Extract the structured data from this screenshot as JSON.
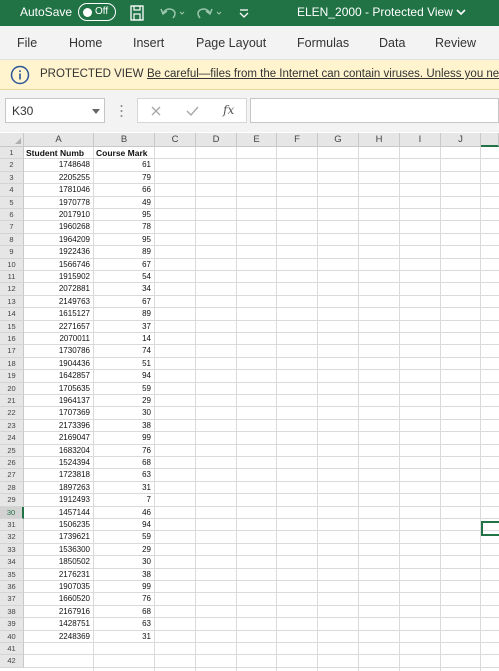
{
  "titlebar": {
    "autosave_label": "AutoSave",
    "autosave_state": "Off",
    "doc_title": "ELEN_2000  -  Protected View"
  },
  "ribbon_tabs": [
    "File",
    "Home",
    "Insert",
    "Page Layout",
    "Formulas",
    "Data",
    "Review"
  ],
  "protected_view": {
    "title": "PROTECTED VIEW",
    "message": "Be careful—files from the Internet can contain viruses. Unless you ne"
  },
  "formula_bar": {
    "name_box": "K30",
    "fx_label": "fx",
    "formula": ""
  },
  "columns": [
    "A",
    "B",
    "C",
    "D",
    "E",
    "F",
    "G",
    "H",
    "I",
    "J"
  ],
  "active_row": 30,
  "sheet": {
    "headers": [
      "Student Numb",
      "Course Mark"
    ],
    "rows": [
      [
        "1748648",
        "61"
      ],
      [
        "2205255",
        "79"
      ],
      [
        "1781046",
        "66"
      ],
      [
        "1970778",
        "49"
      ],
      [
        "2017910",
        "95"
      ],
      [
        "1960268",
        "78"
      ],
      [
        "1964209",
        "95"
      ],
      [
        "1922436",
        "89"
      ],
      [
        "1566746",
        "67"
      ],
      [
        "1915902",
        "54"
      ],
      [
        "2072881",
        "34"
      ],
      [
        "2149763",
        "67"
      ],
      [
        "1615127",
        "89"
      ],
      [
        "2271657",
        "37"
      ],
      [
        "2070011",
        "14"
      ],
      [
        "1730786",
        "74"
      ],
      [
        "1904436",
        "51"
      ],
      [
        "1642857",
        "94"
      ],
      [
        "1705635",
        "59"
      ],
      [
        "1964137",
        "29"
      ],
      [
        "1707369",
        "30"
      ],
      [
        "2173396",
        "38"
      ],
      [
        "2169047",
        "99"
      ],
      [
        "1683204",
        "76"
      ],
      [
        "1524394",
        "68"
      ],
      [
        "1723818",
        "63"
      ],
      [
        "1897263",
        "31"
      ],
      [
        "1912493",
        "7"
      ],
      [
        "1457144",
        "46"
      ],
      [
        "1506235",
        "94"
      ],
      [
        "1739621",
        "59"
      ],
      [
        "1536300",
        "29"
      ],
      [
        "1850502",
        "30"
      ],
      [
        "2176231",
        "38"
      ],
      [
        "1907035",
        "99"
      ],
      [
        "1660520",
        "76"
      ],
      [
        "2167916",
        "68"
      ],
      [
        "1428751",
        "63"
      ],
      [
        "2248369",
        "31"
      ]
    ]
  }
}
